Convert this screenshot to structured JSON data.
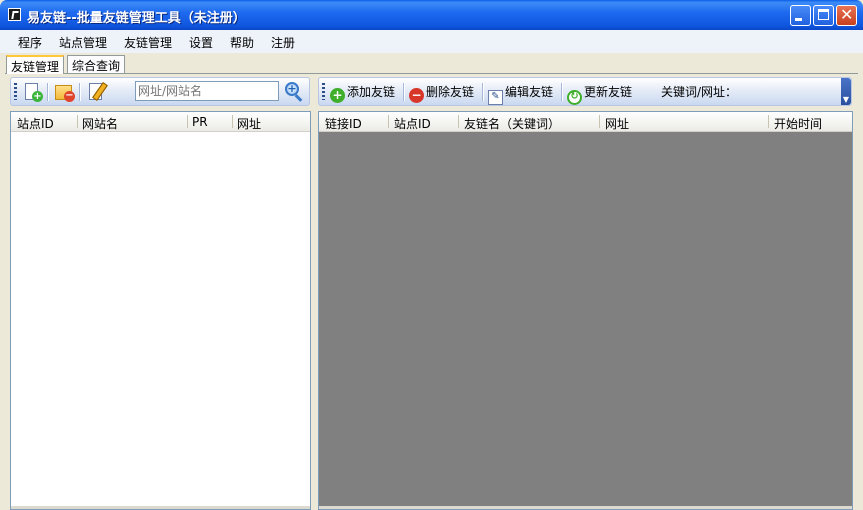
{
  "window": {
    "title": "易友链--批量友链管理工具（未注册）"
  },
  "menu": [
    "程序",
    "站点管理",
    "友链管理",
    "设置",
    "帮助",
    "注册"
  ],
  "tabs": [
    "友链管理",
    "综合查询"
  ],
  "left_toolbar": {
    "search_placeholder": "网址/网站名"
  },
  "right_toolbar": {
    "add": "添加友链",
    "delete": "删除友链",
    "edit": "编辑友链",
    "update": "更新友链",
    "keyword_label": "关键词/网址："
  },
  "left_grid": {
    "columns": [
      "站点ID",
      "网站名",
      "PR",
      "网址"
    ]
  },
  "right_grid": {
    "columns": [
      "链接ID",
      "站点ID",
      "友链名（关键词）",
      "网址",
      "开始时间"
    ]
  }
}
